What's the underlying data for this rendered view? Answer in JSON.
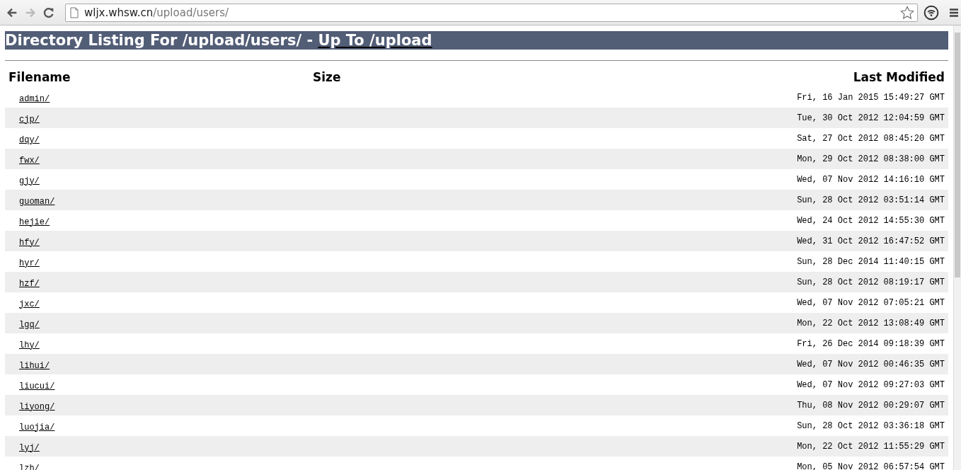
{
  "browser": {
    "url_host": "wljx.whsw.cn",
    "url_path": "/upload/users/"
  },
  "heading": {
    "title": "Directory Listing For /upload/users/ - ",
    "up_link": "Up To /upload"
  },
  "table": {
    "columns": [
      "Filename",
      "Size",
      "Last Modified"
    ],
    "rows": [
      {
        "name": "admin/",
        "modified": "Fri, 16 Jan 2015 15:49:27 GMT"
      },
      {
        "name": "cjp/",
        "modified": "Tue, 30 Oct 2012 12:04:59 GMT"
      },
      {
        "name": "dqy/",
        "modified": "Sat, 27 Oct 2012 08:45:20 GMT"
      },
      {
        "name": "fwx/",
        "modified": "Mon, 29 Oct 2012 08:38:00 GMT"
      },
      {
        "name": "gjy/",
        "modified": "Wed, 07 Nov 2012 14:16:10 GMT"
      },
      {
        "name": "guoman/",
        "modified": "Sun, 28 Oct 2012 03:51:14 GMT"
      },
      {
        "name": "hejie/",
        "modified": "Wed, 24 Oct 2012 14:55:30 GMT"
      },
      {
        "name": "hfy/",
        "modified": "Wed, 31 Oct 2012 16:47:52 GMT"
      },
      {
        "name": "hyr/",
        "modified": "Sun, 28 Dec 2014 11:40:15 GMT"
      },
      {
        "name": "hzf/",
        "modified": "Sun, 28 Oct 2012 08:19:17 GMT"
      },
      {
        "name": "jxc/",
        "modified": "Wed, 07 Nov 2012 07:05:21 GMT"
      },
      {
        "name": "lgq/",
        "modified": "Mon, 22 Oct 2012 13:08:49 GMT"
      },
      {
        "name": "lhy/",
        "modified": "Fri, 26 Dec 2014 09:18:39 GMT"
      },
      {
        "name": "lihui/",
        "modified": "Wed, 07 Nov 2012 00:46:35 GMT"
      },
      {
        "name": "liucui/",
        "modified": "Wed, 07 Nov 2012 09:27:03 GMT"
      },
      {
        "name": "liyong/",
        "modified": "Thu, 08 Nov 2012 00:29:07 GMT"
      },
      {
        "name": "luojia/",
        "modified": "Sun, 28 Oct 2012 03:36:18 GMT"
      },
      {
        "name": "lyj/",
        "modified": "Mon, 22 Oct 2012 11:55:29 GMT"
      },
      {
        "name": "lzh/",
        "modified": "Mon, 05 Nov 2012 06:57:54 GMT"
      }
    ]
  }
}
